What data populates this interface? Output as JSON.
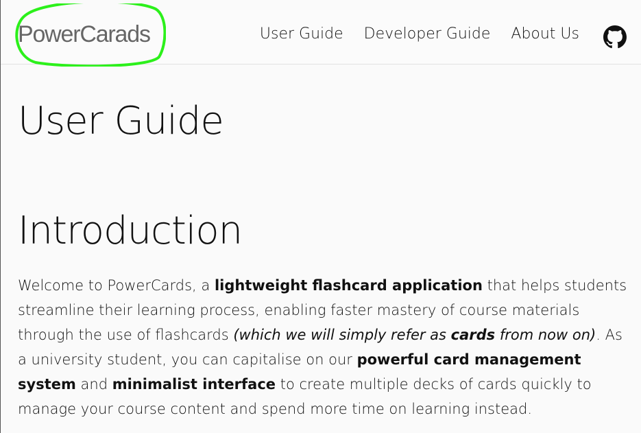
{
  "nav": {
    "brand": "PowerCarads",
    "links": [
      "User Guide",
      "Developer Guide",
      "About Us"
    ],
    "github_icon": "github-icon",
    "highlight_color": "#2cf01b"
  },
  "main": {
    "title": "User Guide",
    "section_title": "Introduction",
    "intro": {
      "p1": "Welcome to PowerCards, a ",
      "b1": "lightweight flashcard application",
      "p2": " that helps students streamline their learning process, enabling faster mastery of course materials through the use of flashcards ",
      "i1": "(which we will simply refer as ",
      "ib1": "cards",
      "i2": " from now on)",
      "p3": ". As a university student, you can capitalise on our ",
      "b2": "powerful card management system",
      "p4": " and ",
      "b3": "minimalist interface",
      "p5": " to create multiple decks of cards quickly to manage your course content and spend more time on learning instead."
    }
  }
}
